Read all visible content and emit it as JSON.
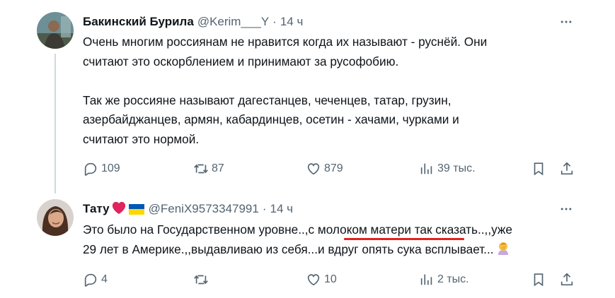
{
  "tweets": [
    {
      "author_name": "Бакинский Бурила",
      "handle": "@Kerim___Y",
      "separator": "·",
      "time": "14 ч",
      "text": "Очень многим россиянам не нравится когда их называют - руснёй. Они\nсчитают это оскорблением и принимают за русофобию.\n\nТак же россияне называют дагестанцев, чеченцев, татар, грузин,\nазербайджанцев, армян, кабардинцев, осетин - хачами, чурками и\nсчитают это нормой.",
      "replies": "109",
      "retweets": "87",
      "likes": "879",
      "views": "39 тыс."
    },
    {
      "author_name": "Тату",
      "handle": "@FeniX9573347991",
      "separator": "·",
      "time": "14 ч",
      "text_before": "Это было на Государственном уровне..,",
      "text_highlight": "с молоком матери",
      "text_after": " так сказать..,,уже\n29 лет в Америке.,,выдавливаю из себя...и вдруг опять сука всплывает...",
      "replies": "4",
      "retweets": "",
      "likes": "10",
      "views": "2 тыс."
    }
  ],
  "colors": {
    "text": "#0f1419",
    "secondary": "#536471",
    "thread_line": "#cfd9de",
    "highlight_underline": "#e32020",
    "flag_blue": "#0057b7",
    "flag_yellow": "#ffd700"
  },
  "icons": [
    "more-icon",
    "reply-icon",
    "retweet-icon",
    "like-icon",
    "views-icon",
    "bookmark-icon",
    "share-icon",
    "heart-emoji-icon",
    "ukraine-flag-icon",
    "facepalm-emoji-icon"
  ]
}
